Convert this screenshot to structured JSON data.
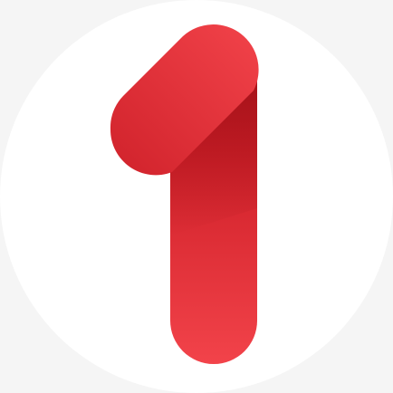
{
  "logo": {
    "name": "number-one-logo",
    "glyph": "1",
    "colors": {
      "page_background": "#f5f5f5",
      "circle_background": "#ffffff",
      "red_light": "#f2434a",
      "red_mid": "#e02a33",
      "red_dark": "#b8141c"
    }
  }
}
